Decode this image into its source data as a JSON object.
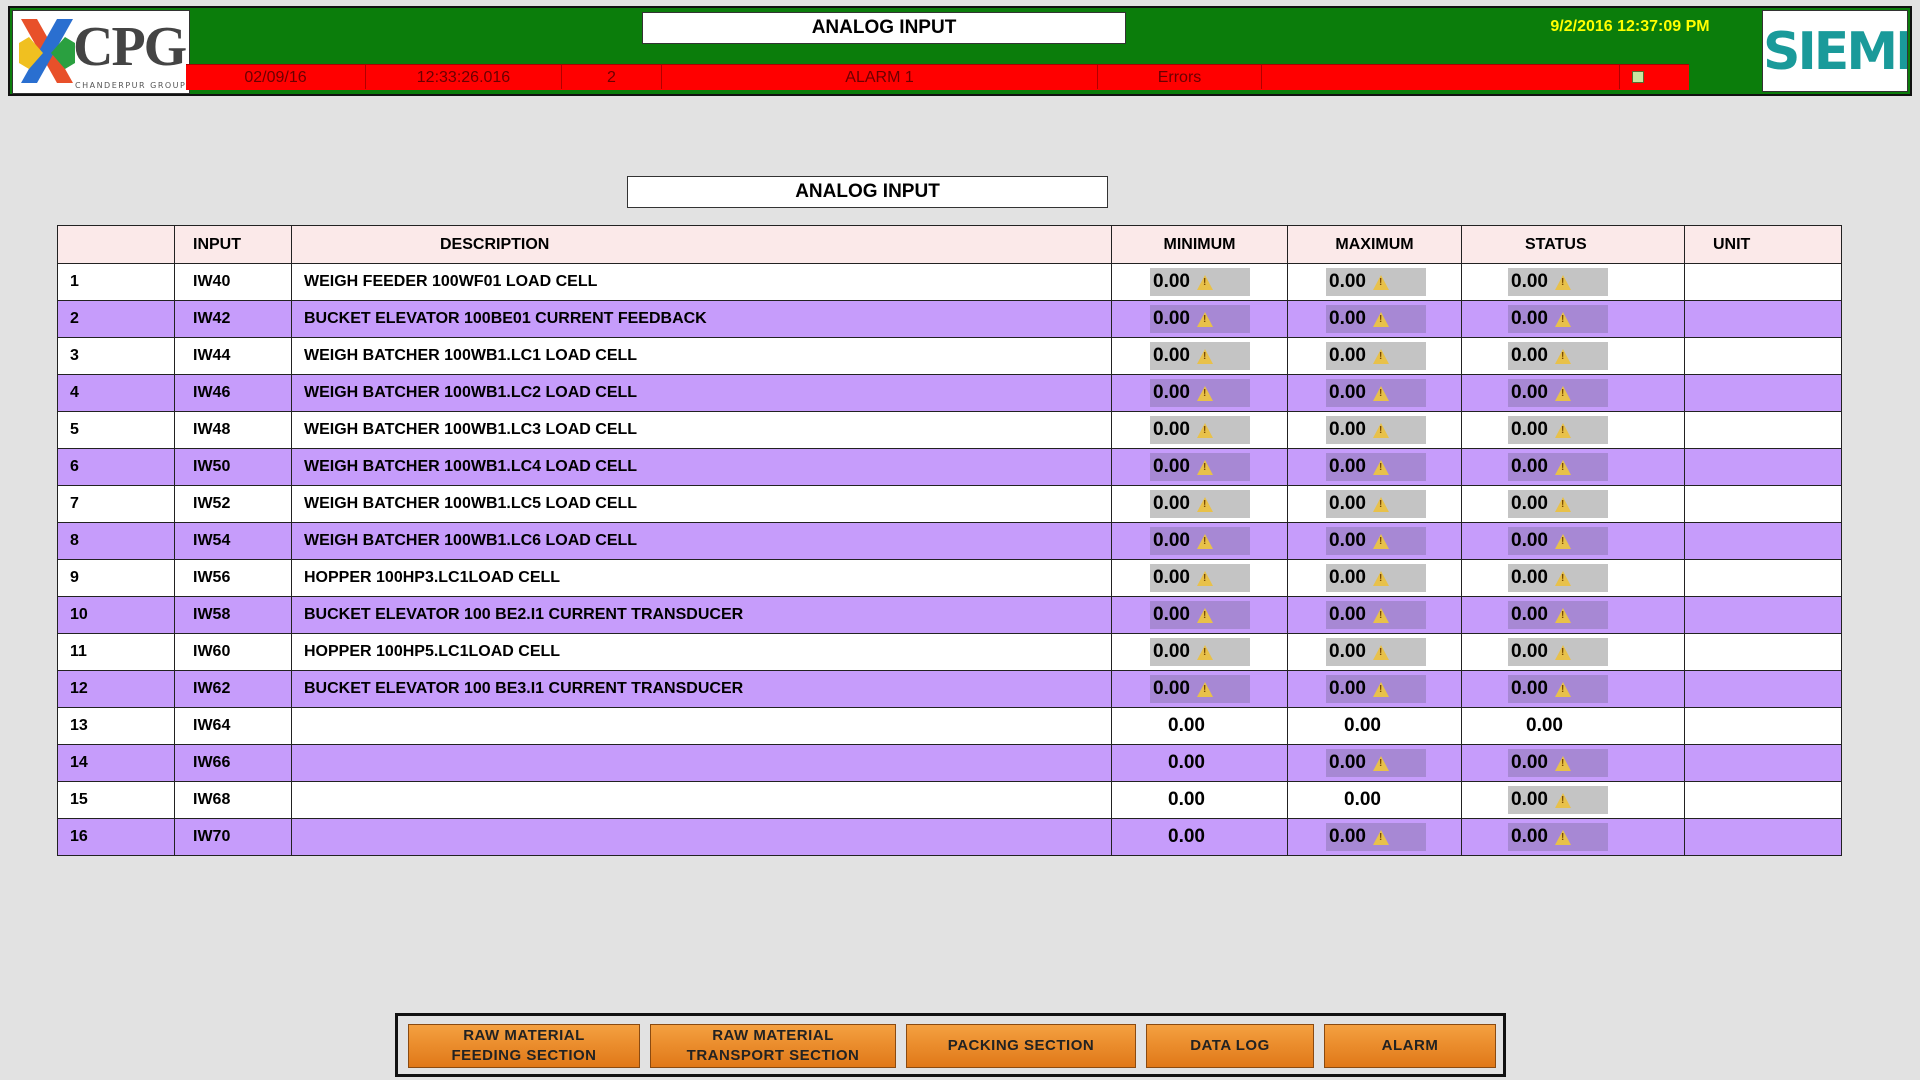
{
  "header": {
    "title": "ANALOG INPUT",
    "clock": "9/2/2016 12:37:09 PM",
    "logo_left": {
      "name": "CPG",
      "subtitle": "CHANDERPUR GROUP"
    },
    "logo_right": "SIEMENS"
  },
  "alarm_bar": {
    "date": "02/09/16",
    "time": "12:33:26.016",
    "number": "2",
    "message": "ALARM 1",
    "type": "Errors",
    "extra": ""
  },
  "section_title": "ANALOG INPUT",
  "table": {
    "columns": [
      "",
      "INPUT",
      "DESCRIPTION",
      "MINIMUM",
      "MAXIMUM",
      "STATUS",
      "UNIT"
    ],
    "rows": [
      {
        "no": "1",
        "input": "IW40",
        "desc": "WEIGH FEEDER 100WF01 LOAD CELL",
        "min": "0.00",
        "max": "0.00",
        "status": "0.00",
        "unit": ""
      },
      {
        "no": "2",
        "input": "IW42",
        "desc": "BUCKET ELEVATOR 100BE01 CURRENT FEEDBACK",
        "min": "0.00",
        "max": "0.00",
        "status": "0.00",
        "unit": ""
      },
      {
        "no": "3",
        "input": "IW44",
        "desc": "WEIGH BATCHER 100WB1.LC1 LOAD CELL",
        "min": "0.00",
        "max": "0.00",
        "status": "0.00",
        "unit": ""
      },
      {
        "no": "4",
        "input": "IW46",
        "desc": "WEIGH BATCHER 100WB1.LC2 LOAD CELL",
        "min": "0.00",
        "max": "0.00",
        "status": "0.00",
        "unit": ""
      },
      {
        "no": "5",
        "input": "IW48",
        "desc": "WEIGH BATCHER 100WB1.LC3 LOAD CELL",
        "min": "0.00",
        "max": "0.00",
        "status": "0.00",
        "unit": ""
      },
      {
        "no": "6",
        "input": "IW50",
        "desc": "WEIGH BATCHER 100WB1.LC4 LOAD CELL",
        "min": "0.00",
        "max": "0.00",
        "status": "0.00",
        "unit": ""
      },
      {
        "no": "7",
        "input": "IW52",
        "desc": "WEIGH BATCHER 100WB1.LC5 LOAD CELL",
        "min": "0.00",
        "max": "0.00",
        "status": "0.00",
        "unit": ""
      },
      {
        "no": "8",
        "input": "IW54",
        "desc": "WEIGH BATCHER 100WB1.LC6 LOAD CELL",
        "min": "0.00",
        "max": "0.00",
        "status": "0.00",
        "unit": ""
      },
      {
        "no": "9",
        "input": "IW56",
        "desc": "HOPPER 100HP3.LC1LOAD CELL",
        "min": "0.00",
        "max": "0.00",
        "status": "0.00",
        "unit": ""
      },
      {
        "no": "10",
        "input": "IW58",
        "desc": "BUCKET ELEVATOR 100 BE2.I1 CURRENT TRANSDUCER",
        "min": "0.00",
        "max": "0.00",
        "status": "0.00",
        "unit": ""
      },
      {
        "no": "11",
        "input": "IW60",
        "desc": "HOPPER 100HP5.LC1LOAD CELL",
        "min": "0.00",
        "max": "0.00",
        "status": "0.00",
        "unit": ""
      },
      {
        "no": "12",
        "input": "IW62",
        "desc": "BUCKET ELEVATOR 100 BE3.I1 CURRENT TRANSDUCER",
        "min": "0.00",
        "max": "0.00",
        "status": "0.00",
        "unit": ""
      },
      {
        "no": "13",
        "input": "IW64",
        "desc": "",
        "min": "0.00",
        "max": "0.00",
        "status": "0.00",
        "unit": ""
      },
      {
        "no": "14",
        "input": "IW66",
        "desc": "",
        "min": "0.00",
        "max": "0.00",
        "status": "0.00",
        "unit": ""
      },
      {
        "no": "15",
        "input": "IW68",
        "desc": "",
        "min": "0.00",
        "max": "0.00",
        "status": "0.00",
        "unit": ""
      },
      {
        "no": "16",
        "input": "IW70",
        "desc": "",
        "min": "0.00",
        "max": "0.00",
        "status": "0.00",
        "unit": ""
      }
    ]
  },
  "nav": {
    "raw_feeding": "RAW MATERIAL\nFEEDING SECTION",
    "raw_transport": "RAW MATERIAL\nTRANSPORT SECTION",
    "packing": "PACKING SECTION",
    "data_log": "DATA LOG",
    "alarm": "ALARM"
  },
  "colors": {
    "header_green": "#0b7d0b",
    "alarm_red": "#ff0000",
    "clock_yellow": "#ffff00",
    "row_purple": "#c69cfb",
    "button_orange": "#e98a2c"
  }
}
